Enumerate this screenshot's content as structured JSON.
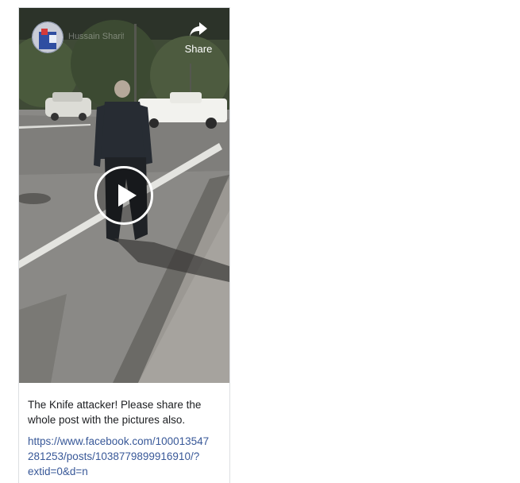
{
  "post": {
    "page_name": "Hussain Sharif",
    "share_label": "Share",
    "caption": "The Knife attacker! Please share the whole post with the pictures also.",
    "link_lines": [
      "https://www.facebook.com/100013547",
      "281253/posts/1038779899916910/?",
      "extid=0&d=n"
    ]
  },
  "icons": {
    "share": "share-arrow-icon",
    "play": "play-icon"
  },
  "colors": {
    "link": "#385898",
    "text": "#1c1e21",
    "border": "#dddfe2"
  }
}
